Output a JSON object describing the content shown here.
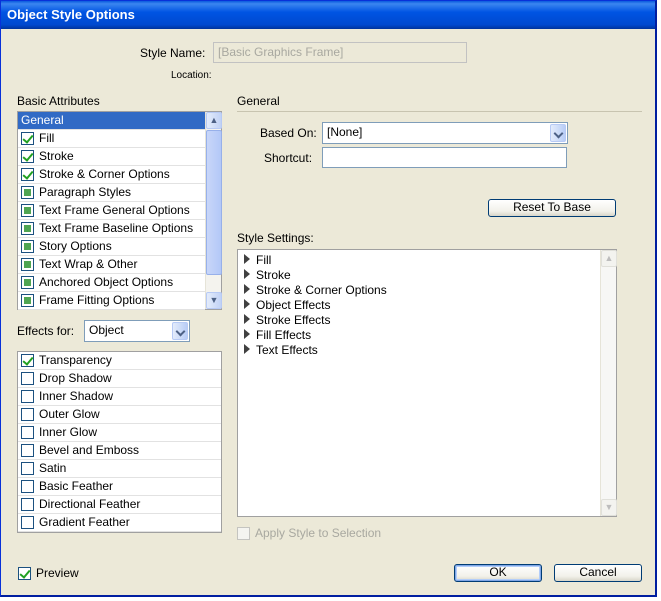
{
  "window": {
    "title": "Object Style Options"
  },
  "style_name": {
    "label": "Style Name:",
    "value": "[Basic Graphics Frame]",
    "location_label": "Location:"
  },
  "basic_attributes": {
    "title": "Basic Attributes",
    "items": [
      {
        "label": "General",
        "state": "selected"
      },
      {
        "label": "Fill",
        "state": "checked"
      },
      {
        "label": "Stroke",
        "state": "checked"
      },
      {
        "label": "Stroke & Corner Options",
        "state": "checked"
      },
      {
        "label": "Paragraph Styles",
        "state": "ignore"
      },
      {
        "label": "Text Frame General Options",
        "state": "ignore"
      },
      {
        "label": "Text Frame Baseline Options",
        "state": "ignore"
      },
      {
        "label": "Story Options",
        "state": "ignore"
      },
      {
        "label": "Text Wrap & Other",
        "state": "ignore"
      },
      {
        "label": "Anchored Object Options",
        "state": "ignore"
      },
      {
        "label": "Frame Fitting Options",
        "state": "ignore"
      }
    ]
  },
  "effects_for": {
    "label": "Effects for:",
    "selected": "Object",
    "items": [
      {
        "label": "Transparency",
        "checked": true
      },
      {
        "label": "Drop Shadow",
        "checked": false
      },
      {
        "label": "Inner Shadow",
        "checked": false
      },
      {
        "label": "Outer Glow",
        "checked": false
      },
      {
        "label": "Inner Glow",
        "checked": false
      },
      {
        "label": "Bevel and Emboss",
        "checked": false
      },
      {
        "label": "Satin",
        "checked": false
      },
      {
        "label": "Basic Feather",
        "checked": false
      },
      {
        "label": "Directional Feather",
        "checked": false
      },
      {
        "label": "Gradient Feather",
        "checked": false
      }
    ]
  },
  "general": {
    "title": "General",
    "based_on_label": "Based On:",
    "based_on_value": "[None]",
    "shortcut_label": "Shortcut:",
    "shortcut_value": "",
    "reset_button": "Reset To Base",
    "style_settings_label": "Style Settings:",
    "style_settings": [
      "Fill",
      "Stroke",
      "Stroke & Corner Options",
      "Object Effects",
      "Stroke Effects",
      "Fill Effects",
      "Text Effects"
    ],
    "apply_label": "Apply Style to Selection"
  },
  "footer": {
    "preview_label": "Preview",
    "ok": "OK",
    "cancel": "Cancel"
  },
  "colors": {
    "selection": "#316ac5",
    "titlebar": "#0054e3",
    "dialog_bg": "#ece9d8"
  }
}
